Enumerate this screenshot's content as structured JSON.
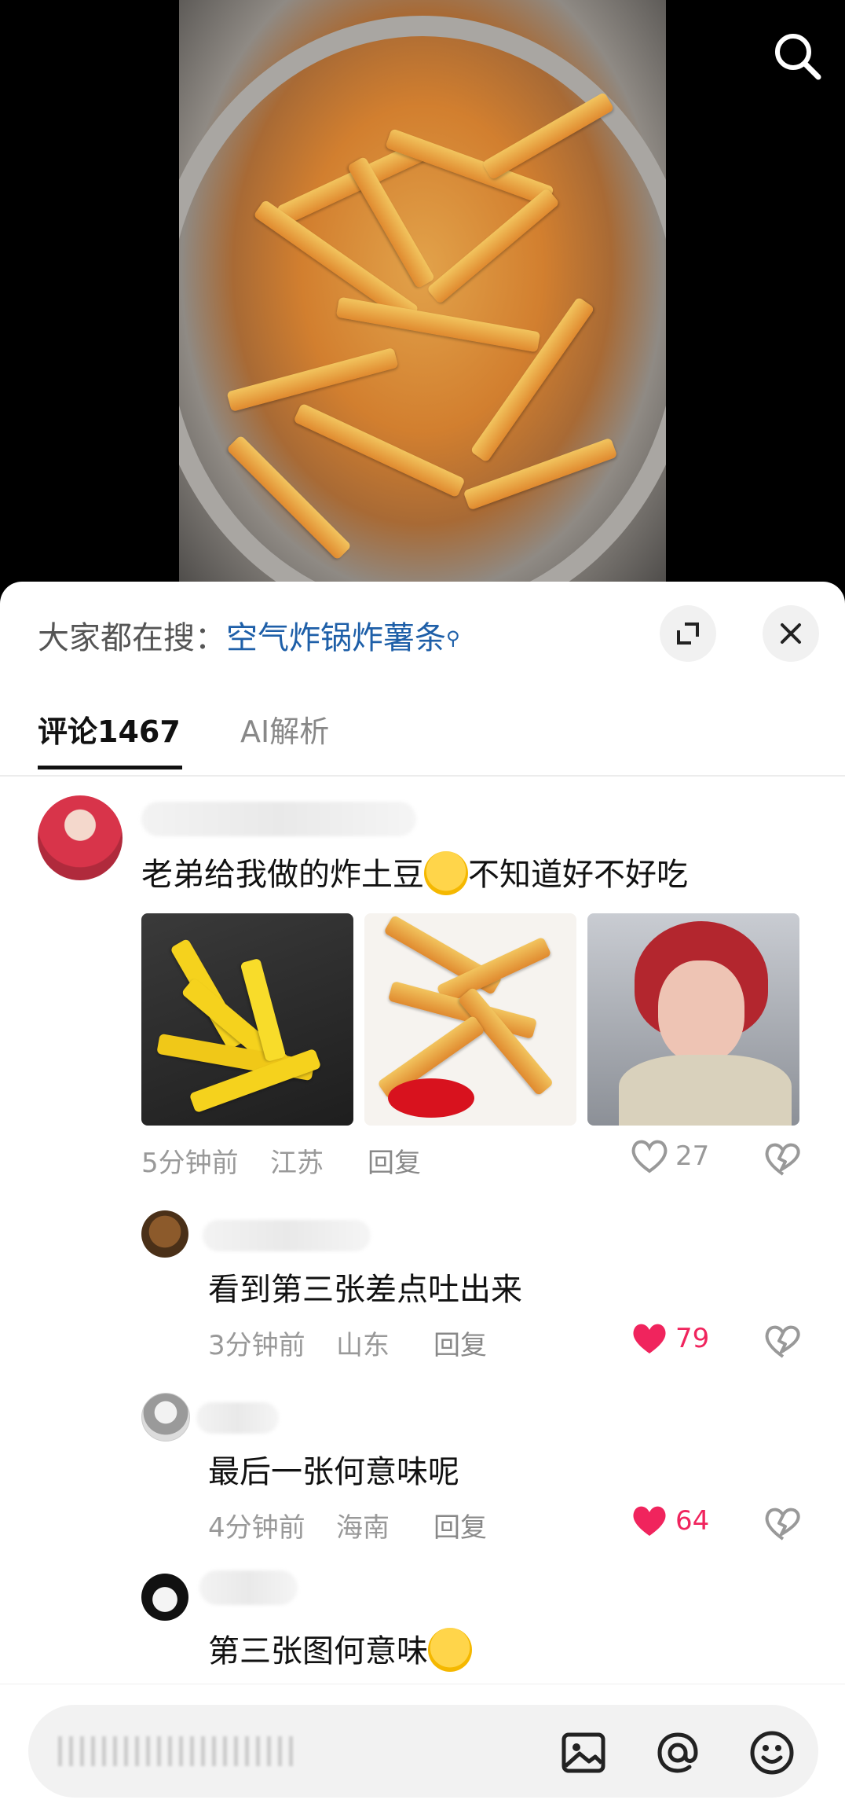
{
  "search_bar": {
    "prefix": "大家都在搜：",
    "keyword": "空气炸锅炸薯条"
  },
  "tabs": [
    {
      "label": "评论1467"
    },
    {
      "label": "AI解析"
    }
  ],
  "main_comment": {
    "text_before": "老弟给我做的炸土豆",
    "text_after": "不知道好不好吃",
    "time": "5分钟前",
    "location": "江苏",
    "reply_label": "回复",
    "likes": "27",
    "liked": false
  },
  "replies": [
    {
      "text": "看到第三张差点吐出来",
      "time": "3分钟前",
      "location": "山东",
      "reply_label": "回复",
      "likes": "79",
      "liked": true
    },
    {
      "text": "最后一张何意味呢",
      "time": "4分钟前",
      "location": "海南",
      "reply_label": "回复",
      "likes": "64",
      "liked": true
    },
    {
      "text": "第三张图何意味"
    }
  ],
  "colors": {
    "keyword": "#1e5fa8",
    "like_active": "#f0245d"
  },
  "icons": [
    "search-icon",
    "expand-icon",
    "close-icon",
    "heart-icon",
    "broken-heart-icon",
    "image-icon",
    "at-icon",
    "emoji-icon"
  ]
}
